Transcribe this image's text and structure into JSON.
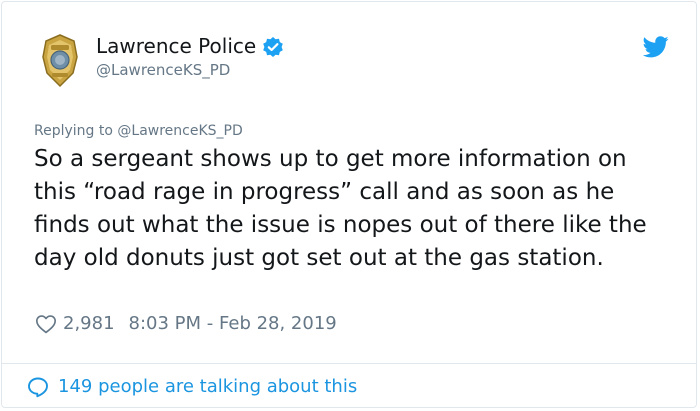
{
  "account": {
    "display_name": "Lawrence Police",
    "handle": "@LawrenceKS_PD"
  },
  "tweet": {
    "reply_prefix": "Replying to",
    "reply_handle": "@LawrenceKS_PD",
    "text": "So a sergeant shows up to get more information on this “road rage in progress” call and as soon as he finds out what the issue is nopes out of there like the day old donuts just got set out at the gas station.",
    "likes": "2,981",
    "timestamp": "8:03 PM - Feb 28, 2019"
  },
  "footer": {
    "conversation_label": "149 people are talking about this"
  },
  "icons": {
    "avatar": "police-badge-icon",
    "verified": "verified-badge-icon",
    "brand": "twitter-bird-icon",
    "like": "heart-icon",
    "conversation": "speech-bubble-icon"
  },
  "colors": {
    "brand_blue": "#1da1f2",
    "link_blue": "#1b95e0",
    "muted_gray": "#657786",
    "text": "#14171a",
    "border": "#e1e8ed",
    "badge_gold": "#c9a441"
  }
}
